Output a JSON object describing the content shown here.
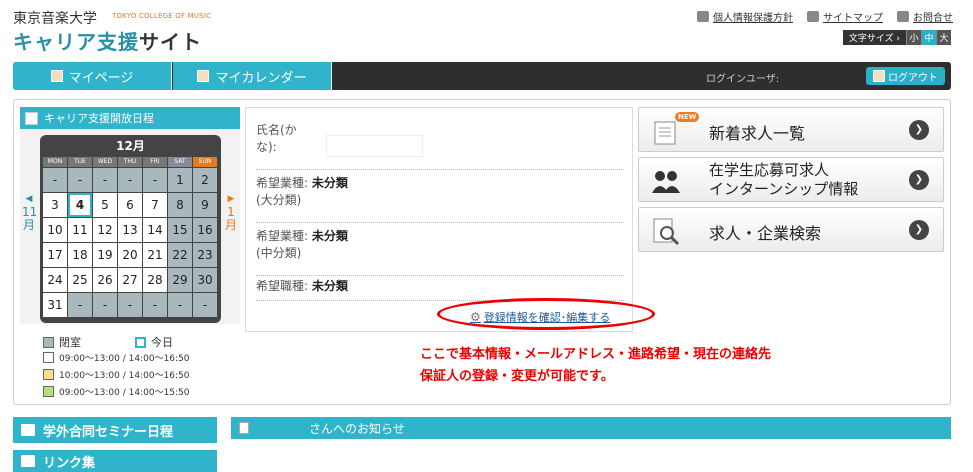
{
  "header": {
    "logo_jp": "東京音楽大学",
    "logo_en": "TOKYO COLLEGE OF MUSIC",
    "site_title_main": "キャリア支援",
    "site_title_sub": "サイト",
    "links": [
      "個人情報保護方針",
      "サイトマップ",
      "お問合せ"
    ],
    "font_size_label": "文字サイズ ›",
    "font_sizes": [
      "小",
      "中",
      "大"
    ],
    "font_size_selected": "中"
  },
  "nav": {
    "tabs": [
      "マイページ",
      "マイカレンダー"
    ],
    "login_user_label": "ログインユーザ:",
    "logout": "ログアウト"
  },
  "calendar": {
    "title": "キャリア支援開放日程",
    "month": "12月",
    "prev_month": "11月",
    "next_month": "1月",
    "weekdays": [
      "MON",
      "TUE",
      "WED",
      "THU",
      "FRI",
      "SAT",
      "SUN"
    ],
    "days": [
      [
        "-",
        "-",
        "-",
        "-",
        "-",
        "1",
        "2"
      ],
      [
        "3",
        "4",
        "5",
        "6",
        "7",
        "8",
        "9"
      ],
      [
        "10",
        "11",
        "12",
        "13",
        "14",
        "15",
        "16"
      ],
      [
        "17",
        "18",
        "19",
        "20",
        "21",
        "22",
        "23"
      ],
      [
        "24",
        "25",
        "26",
        "27",
        "28",
        "29",
        "30"
      ],
      [
        "31",
        "-",
        "-",
        "-",
        "-",
        "-",
        "-"
      ]
    ],
    "today": "4",
    "legend": {
      "closed": "閉室",
      "today": "今日",
      "hours": [
        {
          "text": "09:00～13:00 / 14:00～16:50",
          "color": "#ffffff"
        },
        {
          "text": "10:00～13:00 / 14:00～16:50",
          "color": "#f5e08a"
        },
        {
          "text": "09:00～13:00 / 14:00～15:50",
          "color": "#b8e07a"
        }
      ]
    }
  },
  "profile": {
    "name_kana_label_1": "氏名(か",
    "name_kana_label_2": "な):",
    "job_large_label": "希望業種:",
    "job_large_value": "未分類",
    "job_large_sub": "(大分類)",
    "job_mid_label": "希望業種:",
    "job_mid_value": "未分類",
    "job_mid_sub": "(中分類)",
    "job_type_label": "希望職種:",
    "job_type_value": "未分類",
    "edit_link": "登録情報を確認･編集する"
  },
  "annotation": {
    "line1": "ここで基本情報・メールアドレス・進路希望・現在の連絡先",
    "line2": "保証人の登録・変更が可能です。"
  },
  "buttons": {
    "new_jobs": "新着求人一覧",
    "new_badge": "NEW",
    "student_jobs_1": "在学生応募可求人",
    "student_jobs_2": "インターンシップ情報",
    "search": "求人・企業検索"
  },
  "bottom": {
    "seminar": "学外合同セミナー日程",
    "links": "リンク集",
    "notice": "さんへのお知らせ"
  },
  "colors": {
    "accent": "#30b4cb",
    "navbar": "#2e2e2e",
    "alert": "#e00000",
    "closed": "#a8b8bc"
  }
}
